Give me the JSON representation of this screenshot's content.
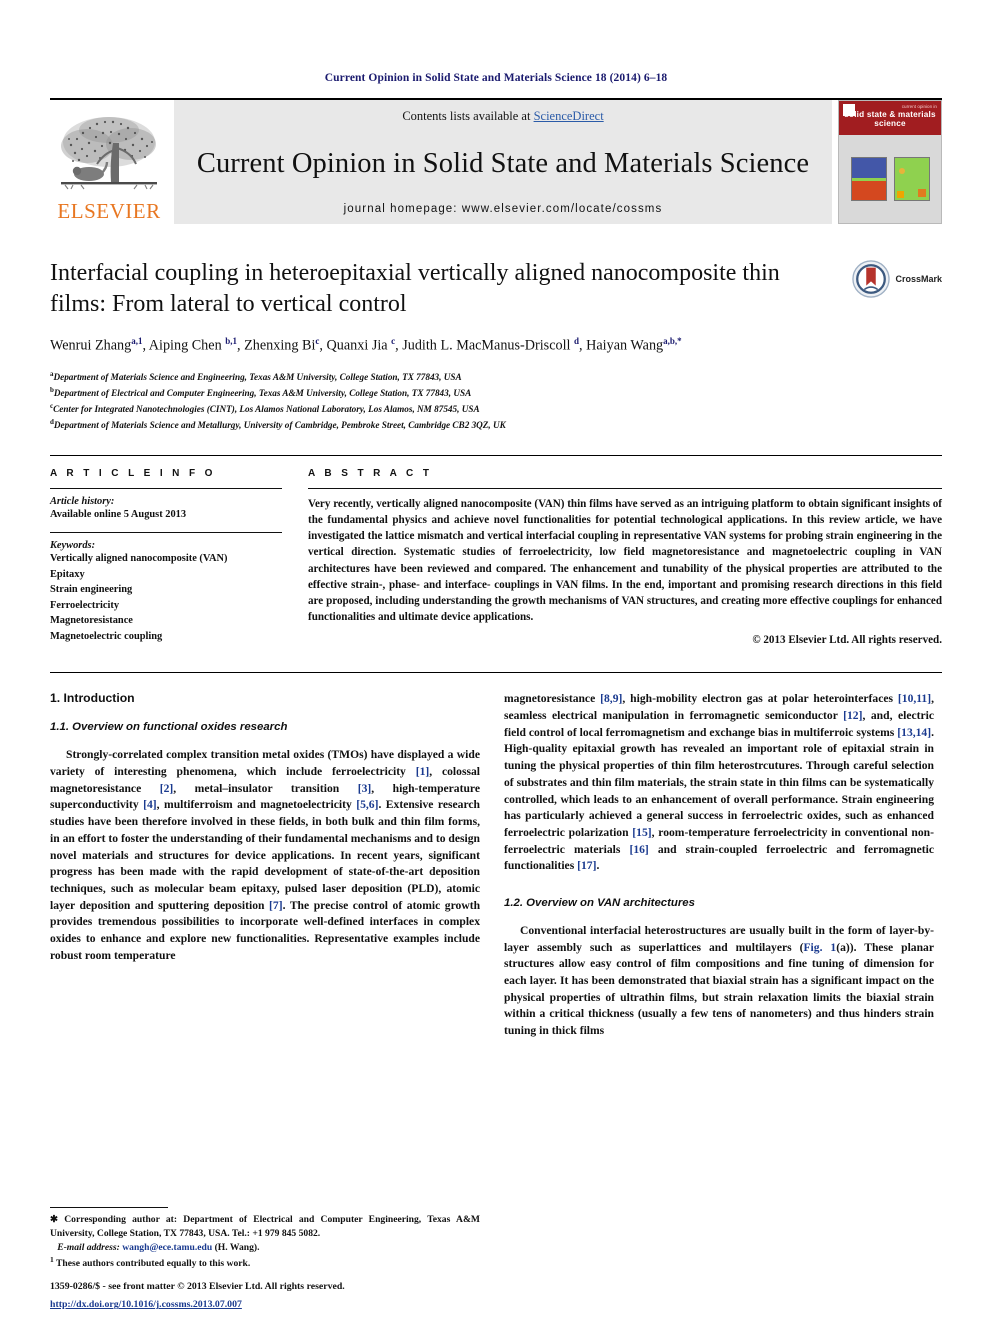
{
  "running_head": "Current Opinion in Solid State and Materials Science 18 (2014) 6–18",
  "masthead": {
    "publisher_name": "ELSEVIER",
    "contents_prefix": "Contents lists available at ",
    "contents_link": "ScienceDirect",
    "journal_title": "Current Opinion in Solid State and Materials Science",
    "homepage": "journal homepage: www.elsevier.com/locate/cossms",
    "cover": {
      "small_line": "current opinion in",
      "large_line": "solid state & materials science"
    }
  },
  "article": {
    "title": "Interfacial coupling in heteroepitaxial vertically aligned nanocomposite thin films: From lateral to vertical control",
    "crossmark_label": "CrossMark",
    "authors_html": "Wenrui Zhang<sup>a,1</sup>, Aiping Chen <sup>b,1</sup>, Zhenxing Bi<sup>c</sup>, Quanxi Jia <sup>c</sup>, Judith L. MacManus-Driscoll <sup>d</sup>, Haiyan Wang<sup>a,b,*</sup>",
    "affiliations": [
      "Department of Materials Science and Engineering, Texas A&M University, College Station, TX 77843, USA",
      "Department of Electrical and Computer Engineering, Texas A&M University, College Station, TX 77843, USA",
      "Center for Integrated Nanotechnologies (CINT), Los Alamos National Laboratory, Los Alamos, NM 87545, USA",
      "Department of Materials Science and Metallurgy, University of Cambridge, Pembroke Street, Cambridge CB2 3QZ, UK"
    ],
    "affiliation_marks": [
      "a",
      "b",
      "c",
      "d"
    ]
  },
  "article_info": {
    "label": "A R T I C L E    I N F O",
    "history_head": "Article history:",
    "history_line": "Available online 5 August 2013",
    "keywords_head": "Keywords:",
    "keywords": [
      "Vertically aligned nanocomposite (VAN)",
      "Epitaxy",
      "Strain engineering",
      "Ferroelectricity",
      "Magnetoresistance",
      "Magnetoelectric coupling"
    ]
  },
  "abstract": {
    "label": "A B S T R A C T",
    "text": "Very recently, vertically aligned nanocomposite (VAN) thin films have served as an intriguing platform to obtain significant insights of the fundamental physics and achieve novel functionalities for potential technological applications. In this review article, we have investigated the lattice mismatch and vertical interfacial coupling in representative VAN systems for probing strain engineering in the vertical direction. Systematic studies of ferroelectricity, low field magnetoresistance and magnetoelectric coupling in VAN architectures have been reviewed and compared. The enhancement and tunability of the physical properties are attributed to the effective strain-, phase- and interface- couplings in VAN films. In the end, important and promising research directions in this field are proposed, including understanding the growth mechanisms of VAN structures, and creating more effective couplings for enhanced functionalities and ultimate device applications.",
    "copyright": "© 2013 Elsevier Ltd. All rights reserved."
  },
  "body": {
    "section1_heading": "1. Introduction",
    "section11_heading": "1.1. Overview on functional oxides research",
    "section12_heading": "1.2. Overview on VAN architectures",
    "left_para1_html": "Strongly-correlated complex transition metal oxides (TMOs) have displayed a wide variety of interesting phenomena, which include ferroelectricity <span class=\"ref\">[1]</span>, colossal magnetoresistance <span class=\"ref\">[2]</span>, metal&#8211;insulator transition <span class=\"ref\">[3]</span>, high-temperature superconductivity <span class=\"ref\">[4]</span>, multiferroism and magnetoelectricity <span class=\"ref\">[5,6]</span>. Extensive research studies have been therefore involved in these fields, in both bulk and thin film forms, in an effort to foster the understanding of their fundamental mechanisms and to design novel materials and structures for device applications. In recent years, significant progress has been made with the rapid development of state-of-the-art deposition techniques, such as molecular beam epitaxy, pulsed laser deposition (PLD), atomic layer deposition and sputtering deposition <span class=\"ref\">[7]</span>. The precise control of atomic growth provides tremendous possibilities to incorporate well-defined interfaces in complex oxides to enhance and explore new functionalities. Representative examples include robust room temperature",
    "right_para1_html": "magnetoresistance <span class=\"ref\">[8,9]</span>, high-mobility electron gas at polar heterointerfaces <span class=\"ref\">[10,11]</span>, seamless electrical manipulation in ferromagnetic semiconductor <span class=\"ref\">[12]</span>, and, electric field control of local ferromagnetism and exchange bias in multiferroic systems <span class=\"ref\">[13,14]</span>. High-quality epitaxial growth has revealed an important role of epitaxial strain in tuning the physical properties of thin film heterostrcutures. Through careful selection of substrates and thin film materials, the strain state in thin films can be systematically controlled, which leads to an enhancement of overall performance. Strain engineering has particularly achieved a general success in ferroelectric oxides, such as enhanced ferroelectric polarization <span class=\"ref\">[15]</span>, room-temperature ferroelectricity in conventional non-ferroelectric materials <span class=\"ref\">[16]</span> and strain-coupled ferroelectric and ferromagnetic functionalities <span class=\"ref\">[17]</span>.",
    "right_para2_html": "Conventional interfacial heterostructures are usually built in the form of layer-by-layer assembly such as superlattices and multilayers (<span class=\"ref\">Fig. 1</span>(a)). These planar structures allow easy control of film compositions and fine tuning of dimension for each layer. It has been demonstrated that biaxial strain has a significant impact on the physical properties of ultrathin films, but strain relaxation limits the biaxial strain within a critical thickness (usually a few tens of nanometers) and thus hinders strain tuning in thick films"
  },
  "footnotes": {
    "corresponding_html": "&#10033; Corresponding author at: Department of Electrical and Computer Engineering, Texas A&amp;M University, College Station, TX 77843, USA. Tel.: +1 979 845 5082.",
    "email_label": "E-mail address:",
    "email_address": "wangh@ece.tamu.edu",
    "email_suffix": "(H. Wang).",
    "equal_contrib_html": "<sup>1</sup> These authors contributed equally to this work.",
    "issn_line": "1359-0286/$ - see front matter © 2013 Elsevier Ltd. All rights reserved.",
    "doi_line": "http://dx.doi.org/10.1016/j.cossms.2013.07.007"
  },
  "colors": {
    "link_blue": "#1a3a8f",
    "header_navy": "#1a1a6e",
    "elsevier_orange": "#E87722",
    "cover_red": "#a11d20",
    "masthead_grey": "#e8e8e8"
  }
}
